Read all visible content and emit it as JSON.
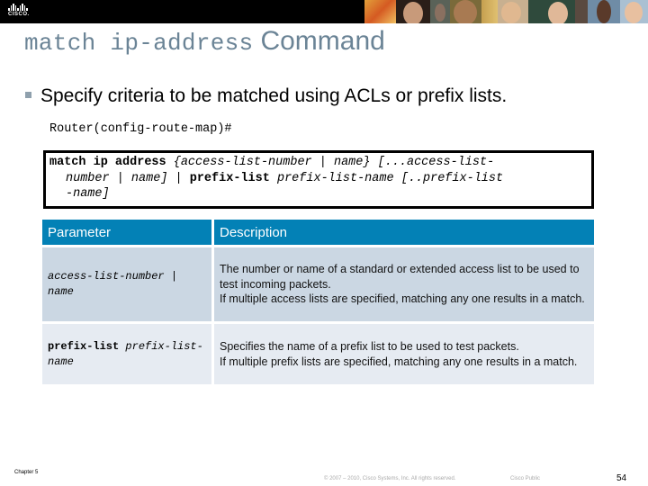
{
  "header": {
    "logo_text": "CISCO.",
    "photo_strip_label": "people-photo-strip",
    "photo_colors": [
      "#d97a2a",
      "#3b2a22",
      "#6a5a40",
      "#c7a25a",
      "#caa17a",
      "#3f5a4a",
      "#7a6a5a",
      "#4a6a80",
      "#9ab0c4"
    ]
  },
  "slide": {
    "title_code": "match ip-address",
    "title_text": "Command",
    "bullet": "Specify criteria to be matched using ACLs or prefix lists.",
    "prompt": "Router(config-route-map)#"
  },
  "syntax": {
    "line1_bold": "match ip address",
    "line1_italic": "{access-list-number | name} [...access-list-",
    "line2_italic_a": "number | name]",
    "line2_sep": " | ",
    "line2_bold": "prefix-list",
    "line2_italic_b": "prefix-list-name [..prefix-list",
    "line3_italic": "-name]"
  },
  "table": {
    "headers": [
      "Parameter",
      "Description"
    ],
    "rows": [
      {
        "param_bold": "",
        "param_italic": "access-list-number",
        "param_plain": " | ",
        "param_italic2": "name",
        "description": [
          "The number or name of a standard or extended access list to be used to test incoming packets.",
          "If multiple access lists are specified, matching any one results in a match."
        ]
      },
      {
        "param_bold": "prefix-list",
        "param_italic": "prefix-list-name",
        "description": [
          "Specifies the name of a prefix list to be used to test packets.",
          "If multiple prefix lists are specified, matching any one results in a match."
        ]
      }
    ]
  },
  "footer": {
    "chapter": "Chapter 5",
    "copyright": "© 2007 – 2010, Cisco Systems, Inc. All rights reserved.",
    "classification": "Cisco Public",
    "page_number": "54"
  }
}
